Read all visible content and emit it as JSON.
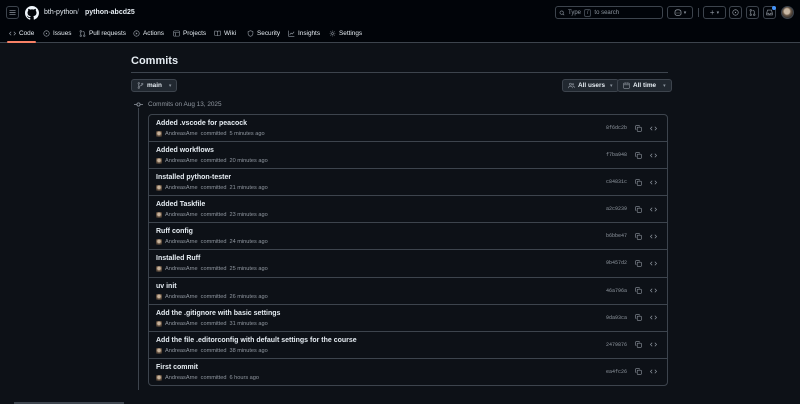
{
  "header": {
    "owner": "bth-python",
    "separator": "/",
    "repo": "python-abcd25",
    "search_label": "Type",
    "search_key": "/",
    "search_suffix": "to search",
    "new_label": "+"
  },
  "nav": {
    "tabs": [
      {
        "label": "Code",
        "icon": "code-icon"
      },
      {
        "label": "Issues",
        "icon": "issue-icon"
      },
      {
        "label": "Pull requests",
        "icon": "pull-request-icon"
      },
      {
        "label": "Actions",
        "icon": "play-icon"
      },
      {
        "label": "Projects",
        "icon": "table-icon"
      },
      {
        "label": "Wiki",
        "icon": "book-icon"
      },
      {
        "label": "Security",
        "icon": "shield-icon"
      },
      {
        "label": "Insights",
        "icon": "graph-icon"
      },
      {
        "label": "Settings",
        "icon": "gear-icon"
      }
    ],
    "selected": "Code"
  },
  "page": {
    "title": "Commits",
    "branch": "main",
    "users_filter": "All users",
    "time_filter": "All time",
    "group_heading": "Commits on Aug 13, 2025"
  },
  "commits": [
    {
      "message": "Added .vscode for peacock",
      "author": "AndreasArne",
      "action": "committed",
      "time": "5 minutes ago",
      "sha": "8f6dc2b"
    },
    {
      "message": "Added workflows",
      "author": "AndreasArne",
      "action": "committed",
      "time": "20 minutes ago",
      "sha": "f7ba948"
    },
    {
      "message": "Installed python-tester",
      "author": "AndreasArne",
      "action": "committed",
      "time": "21 minutes ago",
      "sha": "c84831c"
    },
    {
      "message": "Added Taskfile",
      "author": "AndreasArne",
      "action": "committed",
      "time": "23 minutes ago",
      "sha": "a2c9239"
    },
    {
      "message": "Ruff config",
      "author": "AndreasArne",
      "action": "committed",
      "time": "24 minutes ago",
      "sha": "b6bbe47"
    },
    {
      "message": "Installed Ruff",
      "author": "AndreasArne",
      "action": "committed",
      "time": "25 minutes ago",
      "sha": "9b457d2"
    },
    {
      "message": "uv init",
      "author": "AndreasArne",
      "action": "committed",
      "time": "26 minutes ago",
      "sha": "46a796a"
    },
    {
      "message": "Add the .gitignore with basic settings",
      "author": "AndreasArne",
      "action": "committed",
      "time": "31 minutes ago",
      "sha": "9da93ca"
    },
    {
      "message": "Add the file .editorconfig with default settings for the course",
      "author": "AndreasArne",
      "action": "committed",
      "time": "38 minutes ago",
      "sha": "2479876"
    },
    {
      "message": "First commit",
      "author": "AndreasArne",
      "action": "committed",
      "time": "6 hours ago",
      "sha": "ea4fc26"
    }
  ]
}
